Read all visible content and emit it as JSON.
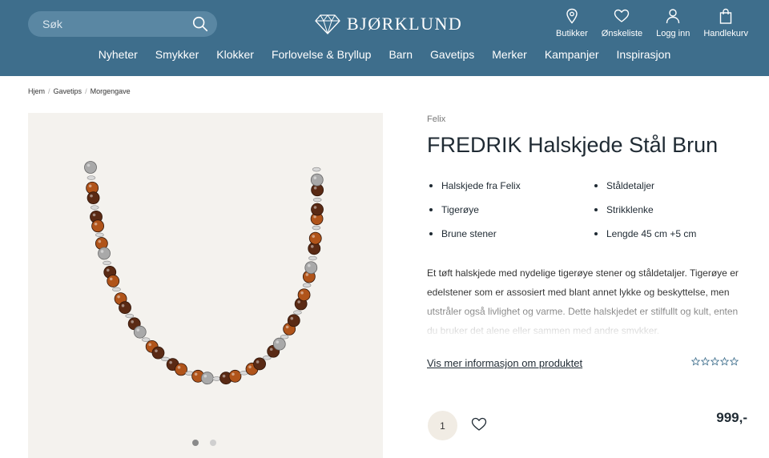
{
  "header": {
    "search": {
      "placeholder": "Søk"
    },
    "logo_text": "BJØRKLUND",
    "actions": [
      {
        "label": "Butikker",
        "icon": "location-pin-icon"
      },
      {
        "label": "Ønskeliste",
        "icon": "heart-icon"
      },
      {
        "label": "Logg inn",
        "icon": "user-icon"
      },
      {
        "label": "Handlekurv",
        "icon": "shopping-bag-icon"
      }
    ],
    "nav": [
      "Nyheter",
      "Smykker",
      "Klokker",
      "Forlovelse & Bryllup",
      "Barn",
      "Gavetips",
      "Merker",
      "Kampanjer",
      "Inspirasjon"
    ]
  },
  "breadcrumb": [
    "Hjem",
    "Gavetips",
    "Morgengave"
  ],
  "gallery": {
    "slides": 2,
    "active_slide": 1
  },
  "product": {
    "brand": "Felix",
    "title": "FREDRIK Halskjede Stål Brun",
    "features": [
      "Halskjede fra Felix",
      "Ståldetaljer",
      "Tigerøye",
      "Strikklenke",
      "Brune stener",
      "Lengde 45 cm +5 cm"
    ],
    "description": "Et tøft halskjede med nydelige tigerøye stener og ståldetaljer. Tigerøye er edelstener som er assosiert med blant annet lykke og beskyttelse, men utstråler også livlighet og varme. Dette halskjedet er stilfullt og kult, enten du bruker det alene eller sammen med andre smykker.",
    "more_info_label": "Vis mer informasjon om produktet",
    "rating": {
      "stars": 0,
      "max": 5
    },
    "quantity": "1",
    "price": "999,-"
  },
  "colors": {
    "header_bg": "#3e6e8c",
    "search_bg": "#5a87a3",
    "gallery_bg": "#f4f2ee",
    "qty_bg": "#f1ece4",
    "bead_dark": "#5a2a14",
    "bead_light": "#b0541a",
    "steel": "#a9a9a9"
  }
}
